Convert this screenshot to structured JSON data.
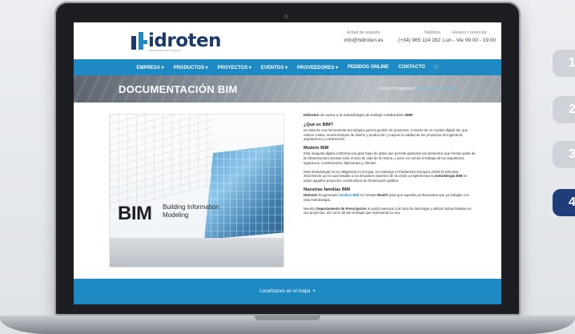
{
  "side_buttons": [
    "1",
    "2",
    "3",
    "4"
  ],
  "header": {
    "logo_text": "idroten",
    "tagline": "Building Information Modeling",
    "email_label": "Email de soporte",
    "email_value": "info@hidroten.es",
    "phone_label": "Teléfono",
    "phone_value": "(+34) 965 114 282",
    "hours_label": "Horario comercial",
    "hours_value": "Lun - Vie 09:00 - 19:00"
  },
  "nav": {
    "items": [
      "EMPRESA ▾",
      "PRODUCTOS ▾",
      "PROYECTOS ▾",
      "EVENTOS ▾",
      "PROVEEDORES ▾",
      "PEDIDOS ONLINE",
      "CONTACTO"
    ],
    "cart_icon": "cart-icon"
  },
  "banner": {
    "title": "DOCUMENTACIÓN BIM",
    "breadcrumb": [
      "Inicio",
      "Proyectos",
      "Documentación BIM"
    ]
  },
  "hero": {
    "bim_text": "BIM",
    "bim_sub": "Building Information Modeling"
  },
  "article": {
    "intro_brand": "Hidroten",
    "intro_rest": " se suma a la metodología de trabajo colaborativo ",
    "intro_bold": "BIM",
    "q1_title": "¿Qué es BIM?",
    "q1_text": "Se trata de una herramienta tecnológica para la gestión de proyectos, a través de un modelo digital 3D, que reduce costes, acorta tiempos de diseño y producción y mejora la calidad de los proyectos de ingeniería, arquitectura y construcción.",
    "model_title": "Modelo BIM",
    "model_text": "Esta maqueta digital conforma una gran base de datos que permite gestionar los elementos que forman parte de la infraestructura durante todo el ciclo de vida de la misma, y pone en común el trabajo de los arquitectos, ingenieros, constructores, fabricantes y clientes.",
    "eu_text_start": "Esta metodología no es obligatoria en Europa, sin embargo el Parlamento Europeo emitió la Directiva 2014/24/UE por la cual instaba a los 28 países miembro de la Unión a implementar la ",
    "eu_bold": "metodología BIM",
    "eu_text_end": " en todos aquellos proyectos constructivos de financiación pública.",
    "families_title": "Nuestras familias BIM",
    "families_brand": "Hidroten",
    "families_mid": " ha generado ",
    "families_link": "familias BIM",
    "families_mid2": " en formato ",
    "families_bold": "Revit®",
    "families_end": " para que aquellos profesionales que ya trabajan con esta metodología.",
    "dept_start": "Nuestro ",
    "dept_bold": "Departamento de Prescripción",
    "dept_end": " le podrá asesorar a la hora de descargar y utilizar dichas familias en sus proyectos, así como de las ventajas que representa su uso."
  },
  "footer": {
    "map_link": "Localízanos en el mapa",
    "pin_icon": "map-pin-icon"
  }
}
